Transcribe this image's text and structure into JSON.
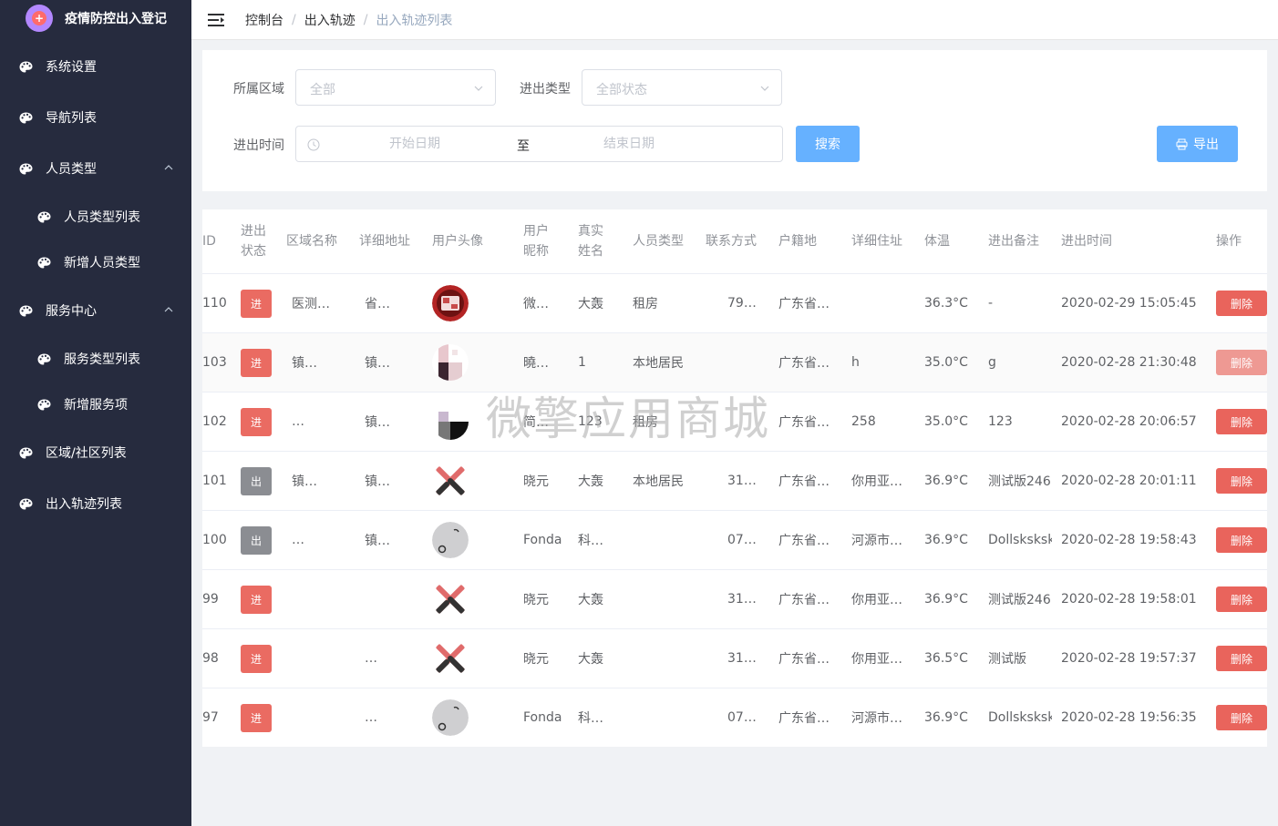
{
  "app": {
    "title": "疫情防控出入登记"
  },
  "sidebar": {
    "items": [
      {
        "label": "系统设置"
      },
      {
        "label": "导航列表"
      },
      {
        "label": "人员类型"
      },
      {
        "label": "人员类型列表"
      },
      {
        "label": "新增人员类型"
      },
      {
        "label": "服务中心"
      },
      {
        "label": "服务类型列表"
      },
      {
        "label": "新增服务项"
      },
      {
        "label": "区域/社区列表"
      },
      {
        "label": "出入轨迹列表"
      }
    ]
  },
  "breadcrumb": {
    "items": [
      "控制台",
      "出入轨迹",
      "出入轨迹列表"
    ],
    "sep": "/"
  },
  "filters": {
    "area_label": "所属区域",
    "area_placeholder": "全部",
    "type_label": "进出类型",
    "type_placeholder": "全部状态",
    "time_label": "进出时间",
    "start_placeholder": "开始日期",
    "range_sep": "至",
    "end_placeholder": "结束日期",
    "search_label": "搜索",
    "export_label": "导出"
  },
  "table": {
    "headers": {
      "id": "ID",
      "status_1": "进出",
      "status_2": "状态",
      "area": "区域名称",
      "address": "详细地址",
      "avatar": "用户头像",
      "nick_1": "用户",
      "nick_2": "昵称",
      "real_1": "真实",
      "real_2": "姓名",
      "ptype": "人员类型",
      "phone": "联系方式",
      "hukou": "户籍地",
      "detail": "详细住址",
      "temp": "体温",
      "note": "进出备注",
      "time": "进出时间",
      "op": "操作"
    },
    "delete_label": "删除",
    "rows": [
      {
        "id": "110",
        "status": "进",
        "area": "医测…",
        "address": "省…",
        "avatar": "photo",
        "nick": "微…",
        "real": "大轰",
        "ptype": "租房",
        "phone": "79…",
        "hukou": "广东省…",
        "detail": "",
        "temp": "36.3°C",
        "note": "-",
        "time": "2020-02-29 15:05:45"
      },
      {
        "id": "103",
        "status": "进",
        "area": "镇…",
        "address": "镇…",
        "avatar": "mosaic-a",
        "nick": "曉…",
        "real": "1",
        "ptype": "本地居民",
        "phone": "",
        "hukou": "广东省…",
        "detail": "h",
        "temp": "35.0°C",
        "note": "g",
        "time": "2020-02-28 21:30:48"
      },
      {
        "id": "102",
        "status": "进",
        "area": "…",
        "address": "镇…",
        "avatar": "mosaic-b",
        "nick": "简…",
        "real": "123",
        "ptype": "租房",
        "phone": "",
        "hukou": "广东省…",
        "detail": "258",
        "temp": "35.0°C",
        "note": "123",
        "time": "2020-02-28 20:06:57"
      },
      {
        "id": "101",
        "status": "出",
        "area": "镇…",
        "address": "镇…",
        "avatar": "cross",
        "nick": "晓元",
        "real": "大轰",
        "ptype": "本地居民",
        "phone": "31…",
        "hukou": "广东省…",
        "detail": "你用亚…",
        "temp": "36.9°C",
        "note": "测试版246",
        "time": "2020-02-28 20:01:11"
      },
      {
        "id": "100",
        "status": "出",
        "area": "…",
        "address": "镇…",
        "avatar": "gray",
        "nick": "Fonda",
        "real": "科…",
        "ptype": "",
        "phone": "07…",
        "hukou": "广东省…",
        "detail": "河源市…",
        "temp": "36.9°C",
        "note": "Dollsksksk",
        "time": "2020-02-28 19:58:43"
      },
      {
        "id": "99",
        "status": "进",
        "area": "",
        "address": "",
        "avatar": "cross",
        "nick": "晓元",
        "real": "大轰",
        "ptype": "",
        "phone": "31…",
        "hukou": "广东省…",
        "detail": "你用亚…",
        "temp": "36.9°C",
        "note": "测试版246",
        "time": "2020-02-28 19:58:01"
      },
      {
        "id": "98",
        "status": "进",
        "area": "",
        "address": "…",
        "avatar": "cross",
        "nick": "晓元",
        "real": "大轰",
        "ptype": "",
        "phone": "31…",
        "hukou": "广东省…",
        "detail": "你用亚…",
        "temp": "36.5°C",
        "note": "测试版",
        "time": "2020-02-28 19:57:37"
      },
      {
        "id": "97",
        "status": "进",
        "area": "",
        "address": "…",
        "avatar": "gray",
        "nick": "Fonda",
        "real": "科…",
        "ptype": "",
        "phone": "07…",
        "hukou": "广东省…",
        "detail": "河源市…",
        "temp": "36.9°C",
        "note": "Dollsksksk",
        "time": "2020-02-28 19:56:35"
      }
    ]
  },
  "watermark": "微擎应用商城",
  "colors": {
    "sidebar_bg": "#262b3e",
    "primary": "#66b1ff",
    "in_badge": "#ea6b62",
    "out_badge": "#8b8d92",
    "delete": "#e9645c"
  }
}
